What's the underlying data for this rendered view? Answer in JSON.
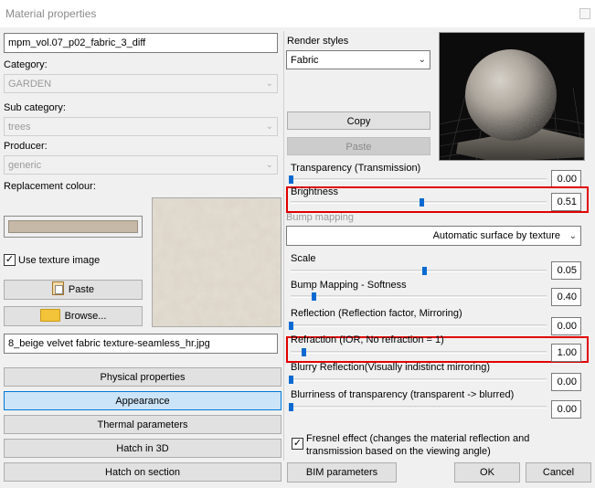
{
  "window": {
    "title": "Material properties"
  },
  "left": {
    "material_name": "mpm_vol.07_p02_fabric_3_diff",
    "category_label": "Category:",
    "category_value": "GARDEN",
    "subcategory_label": "Sub category:",
    "subcategory_value": "trees",
    "producer_label": "Producer:",
    "producer_value": "generic",
    "replacement_label": "Replacement colour:",
    "replacement_colour": "#c6b8a6",
    "use_texture_label": "Use texture image",
    "use_texture_checked": true,
    "paste_label": "Paste",
    "browse_label": "Browse...",
    "texture_file": "8_beige velvet fabric texture-seamless_hr.jpg",
    "nav": [
      {
        "label": "Physical properties",
        "active": false
      },
      {
        "label": "Appearance",
        "active": true
      },
      {
        "label": "Thermal parameters",
        "active": false
      },
      {
        "label": "Hatch in 3D",
        "active": false
      },
      {
        "label": "Hatch on section",
        "active": false
      }
    ]
  },
  "right": {
    "render_styles_label": "Render styles",
    "render_style_value": "Fabric",
    "copy_label": "Copy",
    "paste_label": "Paste",
    "bump_mapping_label": "Bump mapping",
    "bump_mapping_value": "Automatic surface by texture",
    "sliders": [
      {
        "label": "Transparency (Transmission)",
        "value_text": "0.00",
        "value": 0.0
      },
      {
        "label": "Brightness",
        "value_text": "0.51",
        "value": 0.51
      },
      {
        "label": "Scale",
        "value_text": "0.05",
        "value": 0.52
      },
      {
        "label": "Bump Mapping - Softness",
        "value_text": "0.40",
        "value": 0.09
      },
      {
        "label": "Reflection (Reflection factor, Mirroring)",
        "value_text": "0.00",
        "value": 0.0
      },
      {
        "label": "Refraction (IOR, No refraction = 1)",
        "value_text": "1.00",
        "value": 0.05
      },
      {
        "label": "Blurry Reflection(Visually indistinct mirroring)",
        "value_text": "0.00",
        "value": 0.0
      },
      {
        "label": "Blurriness of transparency (transparent -> blurred)",
        "value_text": "0.00",
        "value": 0.0
      }
    ],
    "fresnel_label_1": "Fresnel effect (changes the material reflection and",
    "fresnel_label_2": "transmission based on the viewing angle)",
    "fresnel_checked": true
  },
  "footer": {
    "bim_label": "BIM parameters",
    "ok_label": "OK",
    "cancel_label": "Cancel"
  },
  "colors": {
    "highlight": "#e00000",
    "slider_thumb": "#0a6ad1",
    "active_tab": "#cce4f7"
  }
}
